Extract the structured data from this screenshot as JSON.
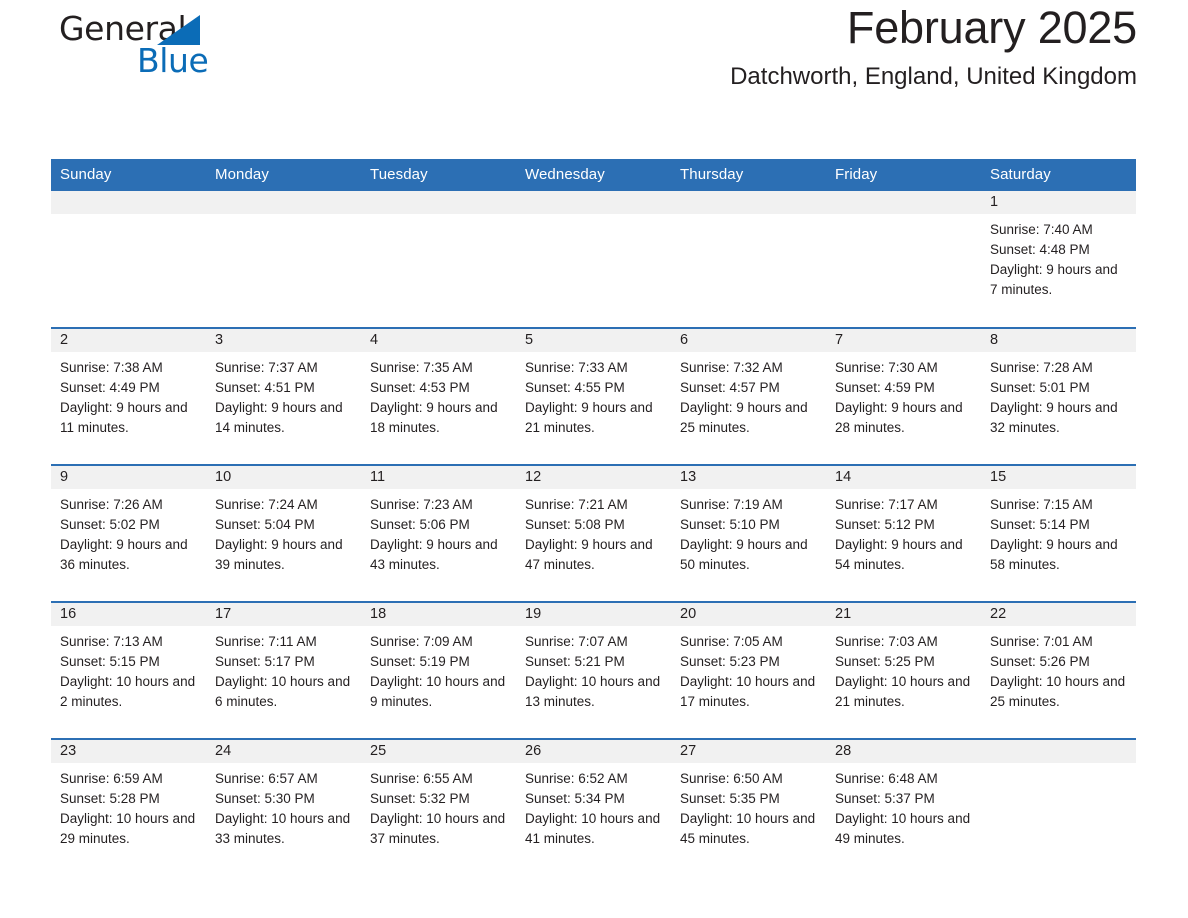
{
  "logo": {
    "line1": "General",
    "line2": "Blue",
    "accent_color": "#0b6cb7",
    "triangle_icon": "triangle-icon"
  },
  "header": {
    "title": "February 2025",
    "subtitle": "Datchworth, England, United Kingdom",
    "header_color": "#2c6fb4"
  },
  "calendar": {
    "weekdays": [
      "Sunday",
      "Monday",
      "Tuesday",
      "Wednesday",
      "Thursday",
      "Friday",
      "Saturday"
    ],
    "weeks": [
      [
        {
          "day": "",
          "sunrise": "",
          "sunset": "",
          "daylight": ""
        },
        {
          "day": "",
          "sunrise": "",
          "sunset": "",
          "daylight": ""
        },
        {
          "day": "",
          "sunrise": "",
          "sunset": "",
          "daylight": ""
        },
        {
          "day": "",
          "sunrise": "",
          "sunset": "",
          "daylight": ""
        },
        {
          "day": "",
          "sunrise": "",
          "sunset": "",
          "daylight": ""
        },
        {
          "day": "",
          "sunrise": "",
          "sunset": "",
          "daylight": ""
        },
        {
          "day": "1",
          "sunrise": "Sunrise: 7:40 AM",
          "sunset": "Sunset: 4:48 PM",
          "daylight": "Daylight: 9 hours and 7 minutes."
        }
      ],
      [
        {
          "day": "2",
          "sunrise": "Sunrise: 7:38 AM",
          "sunset": "Sunset: 4:49 PM",
          "daylight": "Daylight: 9 hours and 11 minutes."
        },
        {
          "day": "3",
          "sunrise": "Sunrise: 7:37 AM",
          "sunset": "Sunset: 4:51 PM",
          "daylight": "Daylight: 9 hours and 14 minutes."
        },
        {
          "day": "4",
          "sunrise": "Sunrise: 7:35 AM",
          "sunset": "Sunset: 4:53 PM",
          "daylight": "Daylight: 9 hours and 18 minutes."
        },
        {
          "day": "5",
          "sunrise": "Sunrise: 7:33 AM",
          "sunset": "Sunset: 4:55 PM",
          "daylight": "Daylight: 9 hours and 21 minutes."
        },
        {
          "day": "6",
          "sunrise": "Sunrise: 7:32 AM",
          "sunset": "Sunset: 4:57 PM",
          "daylight": "Daylight: 9 hours and 25 minutes."
        },
        {
          "day": "7",
          "sunrise": "Sunrise: 7:30 AM",
          "sunset": "Sunset: 4:59 PM",
          "daylight": "Daylight: 9 hours and 28 minutes."
        },
        {
          "day": "8",
          "sunrise": "Sunrise: 7:28 AM",
          "sunset": "Sunset: 5:01 PM",
          "daylight": "Daylight: 9 hours and 32 minutes."
        }
      ],
      [
        {
          "day": "9",
          "sunrise": "Sunrise: 7:26 AM",
          "sunset": "Sunset: 5:02 PM",
          "daylight": "Daylight: 9 hours and 36 minutes."
        },
        {
          "day": "10",
          "sunrise": "Sunrise: 7:24 AM",
          "sunset": "Sunset: 5:04 PM",
          "daylight": "Daylight: 9 hours and 39 minutes."
        },
        {
          "day": "11",
          "sunrise": "Sunrise: 7:23 AM",
          "sunset": "Sunset: 5:06 PM",
          "daylight": "Daylight: 9 hours and 43 minutes."
        },
        {
          "day": "12",
          "sunrise": "Sunrise: 7:21 AM",
          "sunset": "Sunset: 5:08 PM",
          "daylight": "Daylight: 9 hours and 47 minutes."
        },
        {
          "day": "13",
          "sunrise": "Sunrise: 7:19 AM",
          "sunset": "Sunset: 5:10 PM",
          "daylight": "Daylight: 9 hours and 50 minutes."
        },
        {
          "day": "14",
          "sunrise": "Sunrise: 7:17 AM",
          "sunset": "Sunset: 5:12 PM",
          "daylight": "Daylight: 9 hours and 54 minutes."
        },
        {
          "day": "15",
          "sunrise": "Sunrise: 7:15 AM",
          "sunset": "Sunset: 5:14 PM",
          "daylight": "Daylight: 9 hours and 58 minutes."
        }
      ],
      [
        {
          "day": "16",
          "sunrise": "Sunrise: 7:13 AM",
          "sunset": "Sunset: 5:15 PM",
          "daylight": "Daylight: 10 hours and 2 minutes."
        },
        {
          "day": "17",
          "sunrise": "Sunrise: 7:11 AM",
          "sunset": "Sunset: 5:17 PM",
          "daylight": "Daylight: 10 hours and 6 minutes."
        },
        {
          "day": "18",
          "sunrise": "Sunrise: 7:09 AM",
          "sunset": "Sunset: 5:19 PM",
          "daylight": "Daylight: 10 hours and 9 minutes."
        },
        {
          "day": "19",
          "sunrise": "Sunrise: 7:07 AM",
          "sunset": "Sunset: 5:21 PM",
          "daylight": "Daylight: 10 hours and 13 minutes."
        },
        {
          "day": "20",
          "sunrise": "Sunrise: 7:05 AM",
          "sunset": "Sunset: 5:23 PM",
          "daylight": "Daylight: 10 hours and 17 minutes."
        },
        {
          "day": "21",
          "sunrise": "Sunrise: 7:03 AM",
          "sunset": "Sunset: 5:25 PM",
          "daylight": "Daylight: 10 hours and 21 minutes."
        },
        {
          "day": "22",
          "sunrise": "Sunrise: 7:01 AM",
          "sunset": "Sunset: 5:26 PM",
          "daylight": "Daylight: 10 hours and 25 minutes."
        }
      ],
      [
        {
          "day": "23",
          "sunrise": "Sunrise: 6:59 AM",
          "sunset": "Sunset: 5:28 PM",
          "daylight": "Daylight: 10 hours and 29 minutes."
        },
        {
          "day": "24",
          "sunrise": "Sunrise: 6:57 AM",
          "sunset": "Sunset: 5:30 PM",
          "daylight": "Daylight: 10 hours and 33 minutes."
        },
        {
          "day": "25",
          "sunrise": "Sunrise: 6:55 AM",
          "sunset": "Sunset: 5:32 PM",
          "daylight": "Daylight: 10 hours and 37 minutes."
        },
        {
          "day": "26",
          "sunrise": "Sunrise: 6:52 AM",
          "sunset": "Sunset: 5:34 PM",
          "daylight": "Daylight: 10 hours and 41 minutes."
        },
        {
          "day": "27",
          "sunrise": "Sunrise: 6:50 AM",
          "sunset": "Sunset: 5:35 PM",
          "daylight": "Daylight: 10 hours and 45 minutes."
        },
        {
          "day": "28",
          "sunrise": "Sunrise: 6:48 AM",
          "sunset": "Sunset: 5:37 PM",
          "daylight": "Daylight: 10 hours and 49 minutes."
        },
        {
          "day": "",
          "sunrise": "",
          "sunset": "",
          "daylight": ""
        }
      ]
    ]
  }
}
